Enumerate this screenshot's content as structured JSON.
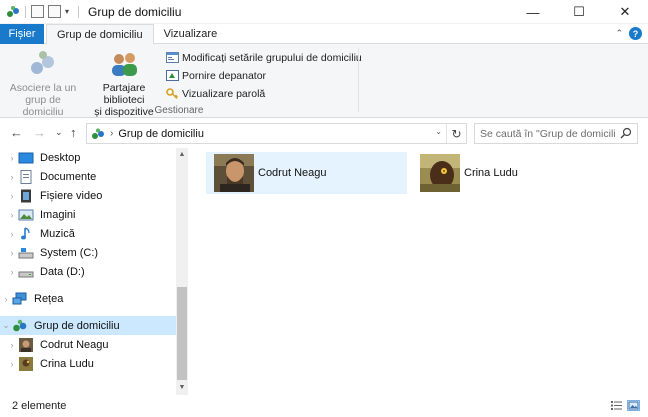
{
  "window": {
    "title": "Grup de domiciliu",
    "minimize_glyph": "—",
    "maximize_glyph": "☐",
    "close_glyph": "✕"
  },
  "quick_access": {
    "dropdown_glyph": "▾"
  },
  "ribbon": {
    "tabs": [
      {
        "label": "Fișier"
      },
      {
        "label": "Grup de domiciliu"
      },
      {
        "label": "Vizualizare"
      }
    ],
    "collapse_glyph": "⌃",
    "help_glyph": "?",
    "big_buttons": [
      {
        "label_line1": "Asociere la un",
        "label_line2": "grup de domiciliu",
        "disabled": true
      },
      {
        "label_line1": "Partajare biblioteci",
        "label_line2": "și dispozitive",
        "disabled": false
      }
    ],
    "small_buttons": [
      {
        "label": "Modificați setările grupului de domiciliu"
      },
      {
        "label": "Pornire depanator"
      },
      {
        "label": "Vizualizare parolă"
      }
    ],
    "group_label": "Gestionare"
  },
  "navigation": {
    "back_glyph": "←",
    "forward_glyph": "→",
    "recent_glyph": "⌄",
    "up_glyph": "↑",
    "breadcrumb_sep": "›",
    "breadcrumb": "Grup de domiciliu",
    "address_dropdown_glyph": "⌄",
    "refresh_glyph": "↻",
    "search_placeholder": "Se caută în \"Grup de domiciliu\""
  },
  "tree": [
    {
      "label": "Desktop",
      "icon": "desktop-icon"
    },
    {
      "label": "Documente",
      "icon": "documents-icon"
    },
    {
      "label": "Fișiere video",
      "icon": "videos-icon"
    },
    {
      "label": "Imagini",
      "icon": "pictures-icon"
    },
    {
      "label": "Muzică",
      "icon": "music-icon"
    },
    {
      "label": "System (C:)",
      "icon": "drive-c-icon"
    },
    {
      "label": "Data (D:)",
      "icon": "drive-d-icon"
    },
    {
      "label": "Rețea",
      "icon": "network-icon"
    },
    {
      "label": "Grup de domiciliu",
      "icon": "homegroup-icon",
      "selected": true
    },
    {
      "label": "Codrut Neagu",
      "icon": "user-avatar-icon"
    },
    {
      "label": "Crina Ludu",
      "icon": "user-avatar-icon"
    }
  ],
  "tree_expand_glyph": "›",
  "tree_collapse_glyph": "⌄",
  "scroll_up_glyph": "▲",
  "scroll_down_glyph": "▼",
  "content": {
    "items": [
      {
        "name": "Codrut Neagu",
        "hovered": true
      },
      {
        "name": "Crina Ludu",
        "hovered": false
      }
    ]
  },
  "status": {
    "item_count": "2 elemente"
  },
  "colors": {
    "accent": "#1979ca",
    "selection": "#cce8ff",
    "hover": "#e5f3ff"
  }
}
